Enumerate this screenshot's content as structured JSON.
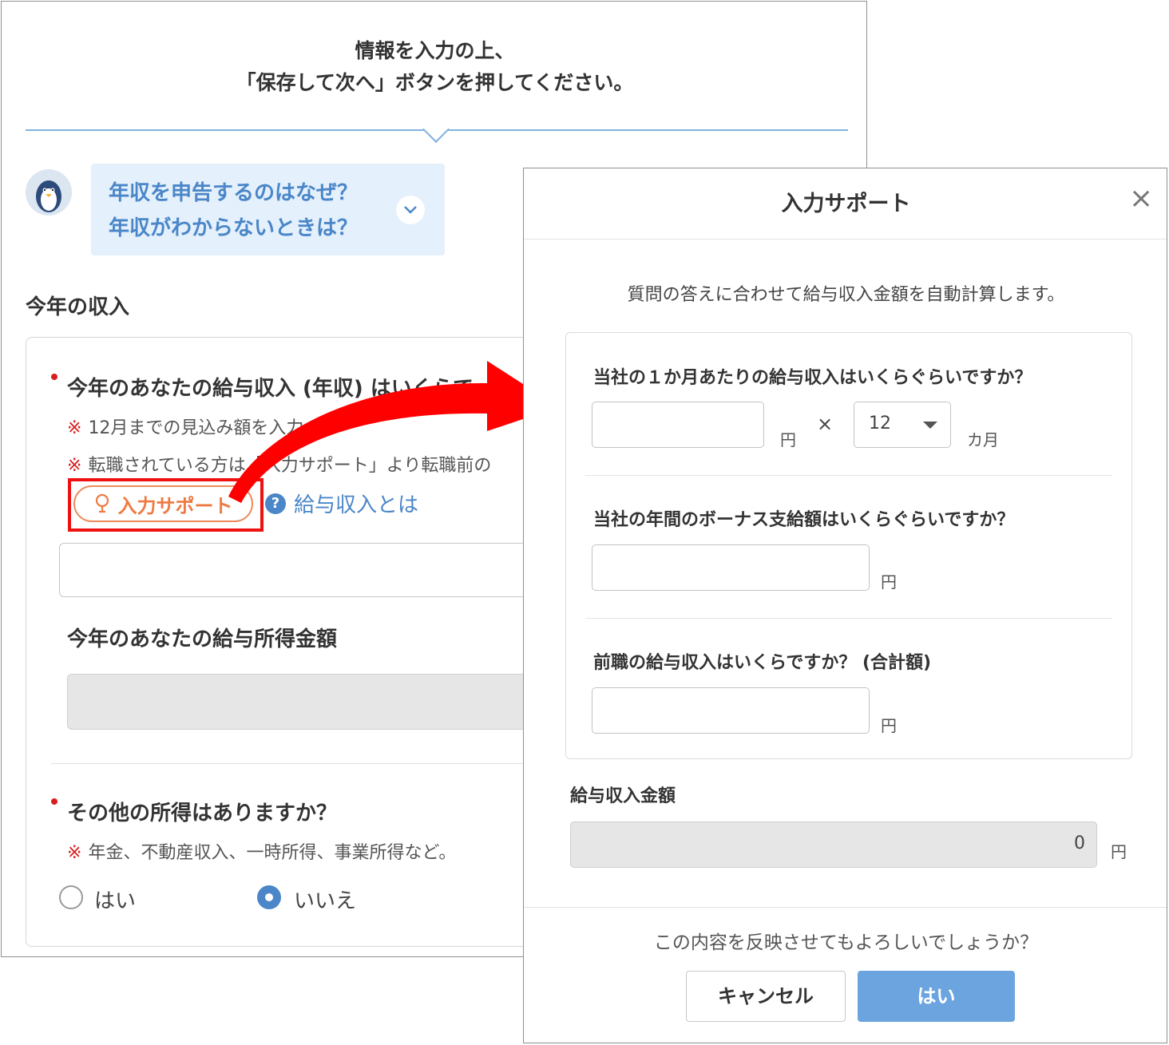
{
  "header": {
    "line1": "情報を入力の上、",
    "line2": "「保存して次へ」ボタンを押してください。"
  },
  "faq": {
    "q1": "年収を申告するのはなぜ？",
    "q2": "年収がわからないときは？"
  },
  "section": {
    "title": "今年の収入"
  },
  "income": {
    "question": "今年のあなたの給与収入 (年収) はいくらで",
    "note1": "12月までの見込み額を入力",
    "note2": "転職されている方は「入力サポート」より転職前の",
    "note_mark": "※",
    "support_label": "入力サポート",
    "help_label": "給与収入とは",
    "value": ""
  },
  "salary_income": {
    "label": "今年のあなたの給与所得金額",
    "value": ""
  },
  "other_income": {
    "question": "その他の所得はありますか？",
    "note": "年金、不動産収入、一時所得、事業所得など。",
    "note_mark": "※",
    "options": [
      "はい",
      "いいえ"
    ],
    "selected": "いいえ"
  },
  "modal": {
    "title": "入力サポート",
    "close_symbol": "×",
    "description": "質問の答えに合わせて給与収入金額を自動計算します。",
    "q_monthly": "当社の１か月あたりの給与収入はいくらぐらいですか？",
    "unit_yen": "円",
    "times": "×",
    "months_value": "12",
    "unit_months": "カ月",
    "q_bonus": "当社の年間のボーナス支給額はいくらぐらいですか？",
    "q_previous": "前職の給与収入はいくらですか？ (合計額)",
    "total_label": "給与収入金額",
    "total_value": "0",
    "confirm": "この内容を反映させてもよろしいでしょうか？",
    "cancel_label": "キャンセル",
    "yes_label": "はい"
  },
  "colors": {
    "accent": "#4a86c8",
    "primary_button": "#6ca4e0",
    "highlight": "#ee1111",
    "support_orange": "#ee7a42",
    "required": "#d81e1e"
  }
}
